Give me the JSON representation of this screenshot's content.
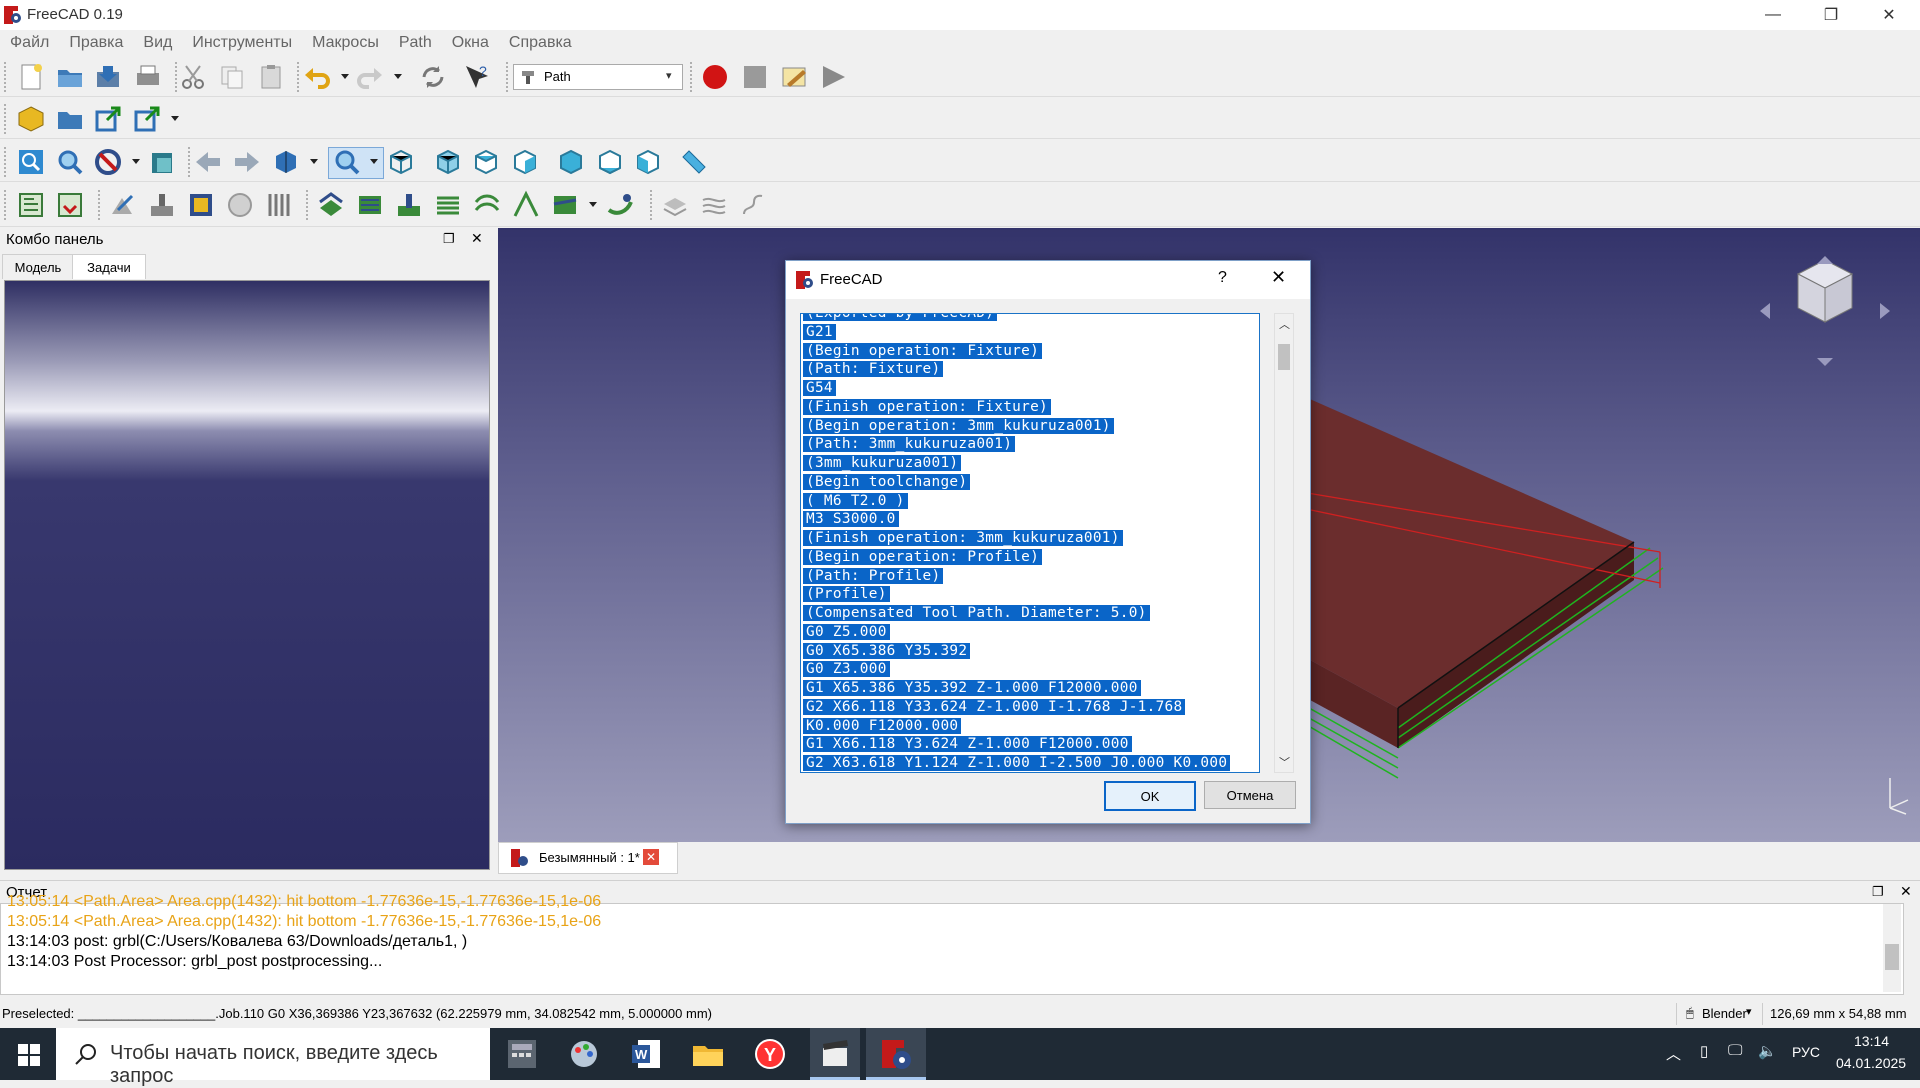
{
  "window": {
    "title": "FreeCAD 0.19",
    "minimize": "—",
    "maximize": "❐",
    "close": "✕"
  },
  "menu": [
    "Файл",
    "Правка",
    "Вид",
    "Инструменты",
    "Макросы",
    "Path",
    "Окна",
    "Справка"
  ],
  "toolbar": {
    "workbench": "Path"
  },
  "combo": {
    "title": "Комбо панель",
    "tabs": [
      "Модель",
      "Задачи"
    ],
    "active_tab": "Задачи"
  },
  "document_tab": "Безымянный : 1*",
  "dialog": {
    "title": "FreeCAD",
    "help": "?",
    "ok": "OK",
    "cancel": "Отмена",
    "lines": [
      "(Exported by FreeCAD)",
      "G21",
      "(Begin operation: Fixture)",
      "(Path: Fixture)",
      "G54",
      "(Finish operation: Fixture)",
      "(Begin operation: 3mm_kukuruza001)",
      "(Path: 3mm_kukuruza001)",
      "(3mm_kukuruza001)",
      "(Begin toolchange)",
      "( M6 T2.0 )",
      "M3 S3000.0",
      "(Finish operation: 3mm_kukuruza001)",
      "(Begin operation: Profile)",
      "(Path: Profile)",
      "(Profile)",
      "(Compensated Tool Path. Diameter: 5.0)",
      "G0 Z5.000",
      "G0 X65.386 Y35.392",
      "G0 Z3.000",
      "G1 X65.386 Y35.392 Z-1.000 F12000.000",
      "G2 X66.118 Y33.624 Z-1.000 I-1.768 J-1.768",
      "K0.000 F12000.000",
      "G1 X66.118 Y3.624 Z-1.000 F12000.000",
      "G2 X63.618 Y1.124 Z-1.000 I-2.500 J0.000 K0.000"
    ]
  },
  "report": {
    "title": "Отчет",
    "lines": [
      {
        "text": "13:05:14  <Path.Area> Area.cpp(1432): hit bottom -1.77636e-15,-1.77636e-15,1e-06",
        "color": "#e8a317"
      },
      {
        "text": "13:05:14  <Path.Area> Area.cpp(1432): hit bottom -1.77636e-15,-1.77636e-15,1e-06",
        "color": "#e8a317"
      },
      {
        "text": "13:14:03  post: grbl(C:/Users/Ковалева 63/Downloads/деталь1, )",
        "color": "#000000"
      },
      {
        "text": "13:14:03  Post Processor: grbl_post postprocessing...",
        "color": "#000000"
      }
    ]
  },
  "status": {
    "preselected": "Preselected: ___________________.Job.110 G0 X36,369386 Y23,367632 (62.225979 mm, 34.082542 mm, 5.000000 mm)",
    "navigation": "Blender",
    "dimensions": "126,69 mm x 54,88 mm"
  },
  "taskbar": {
    "search_placeholder": "Чтобы начать поиск, введите здесь запрос",
    "lang": "РУС",
    "time": "13:14",
    "date": "04.01.2025"
  },
  "colors": {
    "selection": "#0a65c8",
    "warning": "#e8a317",
    "accent": "#1a73c7"
  }
}
